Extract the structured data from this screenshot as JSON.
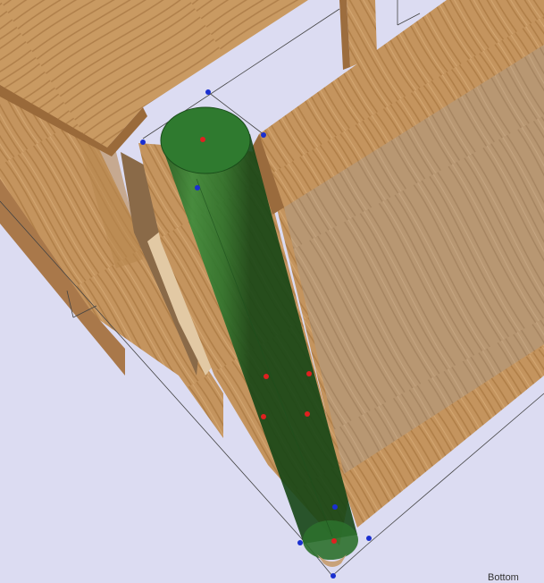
{
  "viewport": {
    "view_name": "Bottom",
    "background": "#dcdcf2",
    "selected_part": "round-dowel",
    "part_color": "#2e7a2e",
    "control_point_colors": {
      "axis_points": "#e02020",
      "bounding_points": "#1a2fd0"
    },
    "materials": [
      "oak-frame",
      "oak-panel",
      "oak-top"
    ]
  }
}
